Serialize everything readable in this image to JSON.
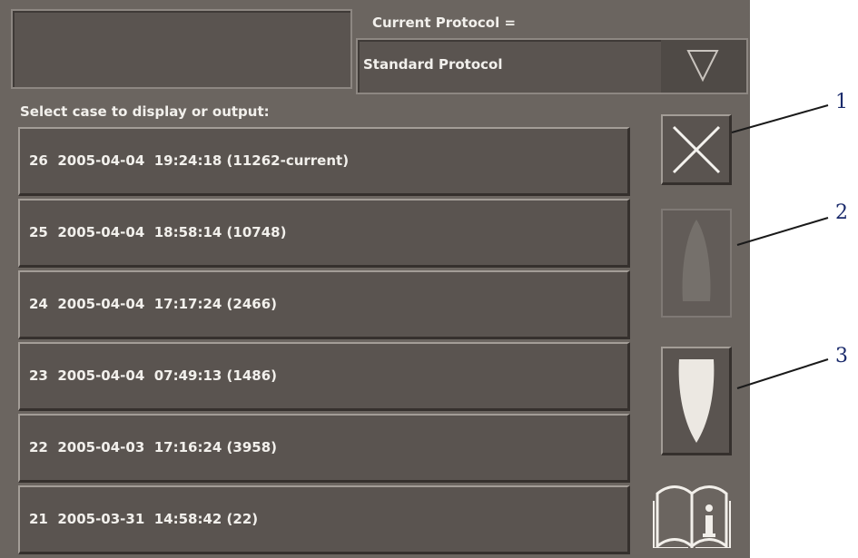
{
  "header": {
    "current_protocol_label": "Current Protocol =",
    "protocol_value": "Standard Protocol",
    "protocol_dropdown_icon": "triangle-down-icon"
  },
  "case_list": {
    "label": "Select case to display or output:",
    "cases": [
      {
        "text": "26  2005-04-04  19:24:18 (11262-current)"
      },
      {
        "text": "25  2005-04-04  18:58:14 (10748)"
      },
      {
        "text": "24  2005-04-04  17:17:24 (2466)"
      },
      {
        "text": "23  2005-04-04  07:49:13 (1486)"
      },
      {
        "text": "22  2005-04-03  17:16:24 (3958)"
      },
      {
        "text": "21  2005-03-31  14:58:42 (22)"
      }
    ]
  },
  "side_buttons": {
    "close_icon": "close-x-icon",
    "scroll_up_icon": "scroll-up-icon",
    "scroll_up_enabled": false,
    "scroll_down_icon": "scroll-down-icon",
    "help_icon": "book-info-icon"
  },
  "callouts": [
    "1",
    "2",
    "3"
  ]
}
